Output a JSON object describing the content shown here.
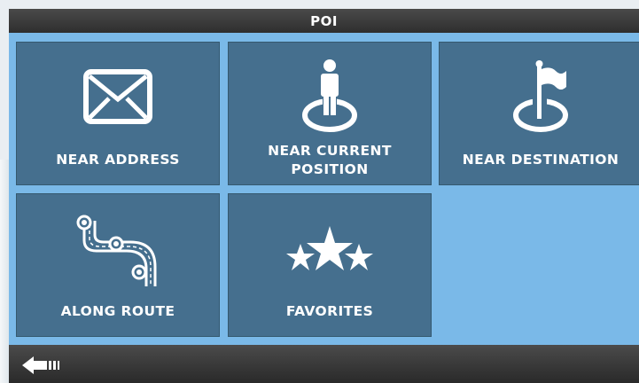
{
  "header": {
    "title": "POI"
  },
  "tiles": [
    {
      "label": "NEAR ADDRESS",
      "icon": "envelope-icon"
    },
    {
      "label": "NEAR CURRENT POSITION",
      "icon": "person-on-location-icon"
    },
    {
      "label": "NEAR DESTINATION",
      "icon": "flag-on-location-icon"
    },
    {
      "label": "ALONG ROUTE",
      "icon": "route-icon"
    },
    {
      "label": "FAVORITES",
      "icon": "stars-icon"
    }
  ],
  "footer": {
    "back_icon": "back-arrow-icon"
  },
  "colors": {
    "background": "#7ab9e8",
    "tile": "#456f8e",
    "bar": "#3a3a3a",
    "text": "#ffffff"
  }
}
